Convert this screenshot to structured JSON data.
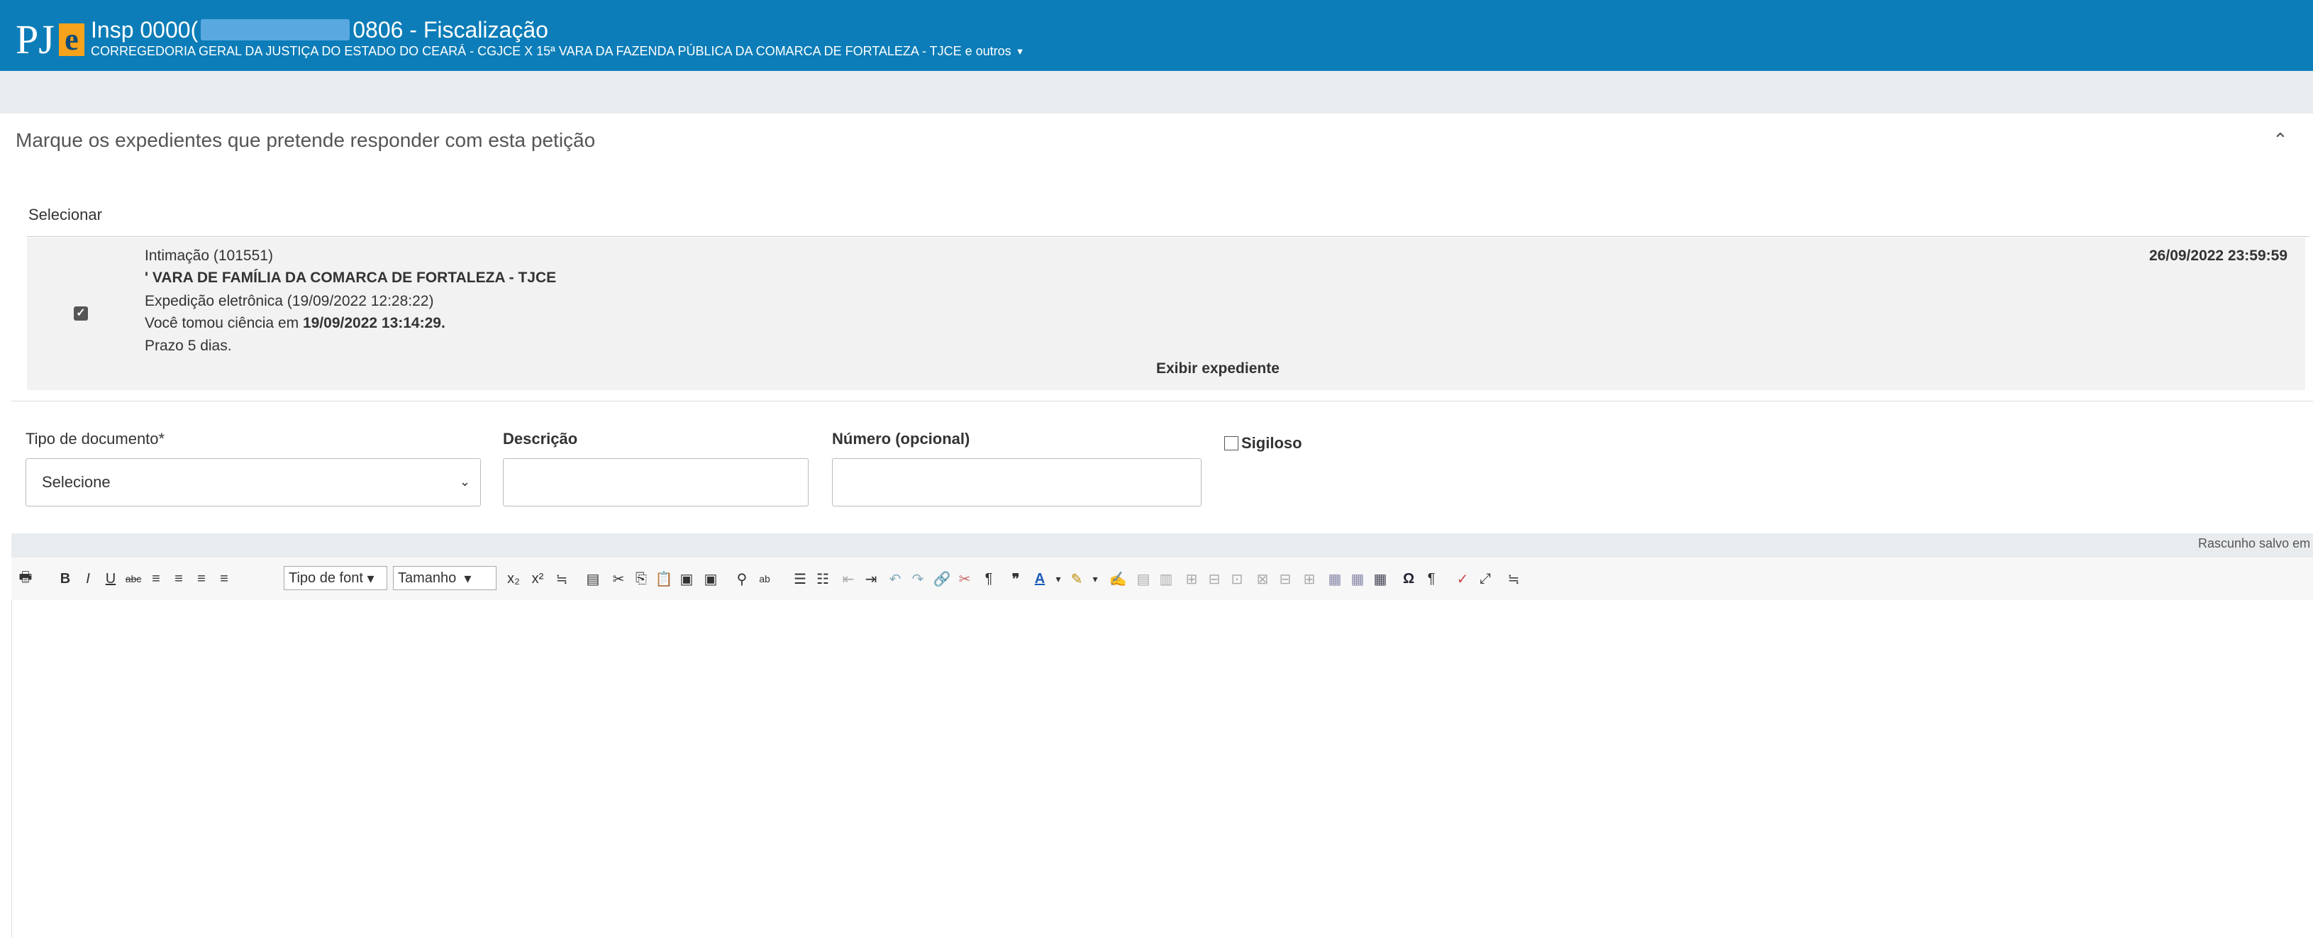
{
  "header": {
    "logo_text": "PJ",
    "logo_e": "e",
    "title_prefix": "Insp 0000(",
    "title_suffix": "0806 - Fiscalização",
    "subtitle": "CORREGEDORIA GERAL DA JUSTIÇA DO ESTADO DO CEARÁ - CGJCE X 15ª VARA DA FAZENDA PÚBLICA DA COMARCA DE FORTALEZA - TJCE e outros",
    "colors": {
      "bar": "#0c7db8",
      "logo_accent": "#f6a21a"
    }
  },
  "expedientes": {
    "title": "Marque os expedientes que pretende responder com esta petição",
    "select_label": "Selecionar",
    "items": [
      {
        "checked": true,
        "tipo": "Intimação (101551)",
        "orgao": "' VARA DE FAMÍLIA DA COMARCA DE FORTALEZA - TJCE",
        "expedicao": "Expedição eletrônica (19/09/2022 12:28:22)",
        "ciencia_prefix": "Você tomou ciência em ",
        "ciencia_data": "19/09/2022 13:14:29.",
        "prazo": "Prazo 5 dias.",
        "data_limite": "26/09/2022 23:59:59",
        "exibir_label": "Exibir expediente"
      }
    ]
  },
  "form": {
    "tipo_label": "Tipo de documento*",
    "tipo_value": "Selecione",
    "descricao_label": "Descrição",
    "descricao_value": "",
    "numero_label": "Número (opcional)",
    "numero_value": "",
    "sigiloso_label": "Sigiloso",
    "sigiloso_checked": false
  },
  "editor": {
    "status": "Rascunho salvo em",
    "font_select": "Tipo de font",
    "size_select": "Tamanho"
  }
}
